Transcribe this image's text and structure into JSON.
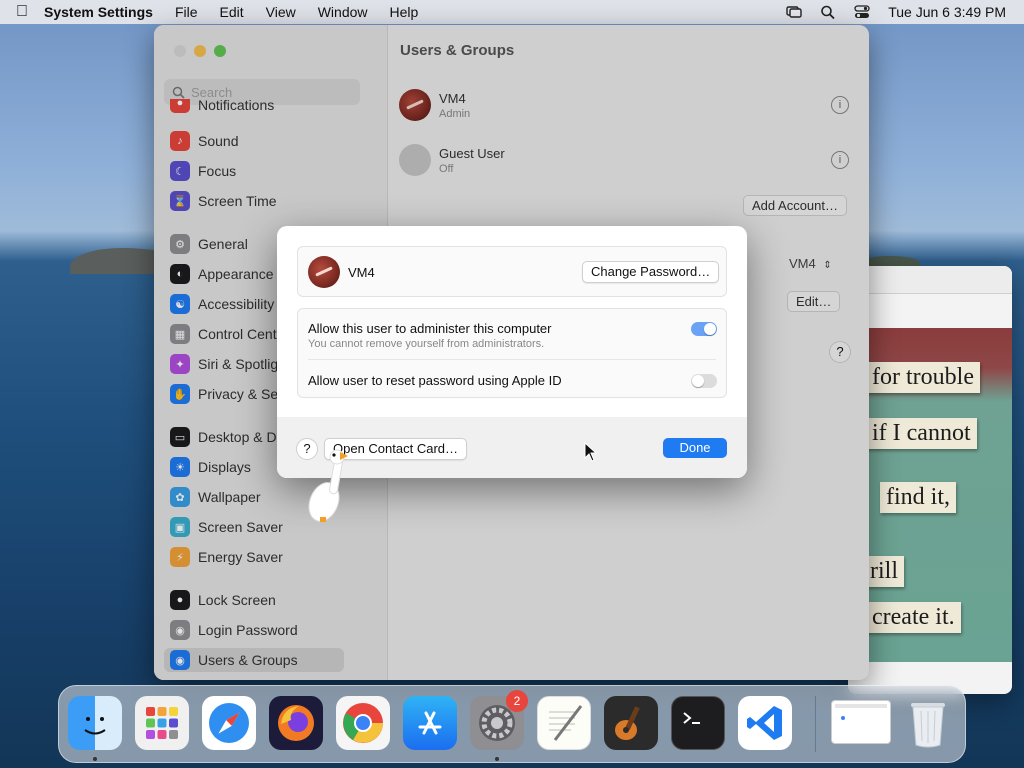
{
  "menubar": {
    "app_name": "System Settings",
    "menus": [
      "File",
      "Edit",
      "View",
      "Window",
      "Help"
    ],
    "datetime": "Tue Jun 6  3:49 PM"
  },
  "settings": {
    "title": "Users & Groups",
    "search_placeholder": "Search",
    "sidebar": [
      {
        "label": "Notifications",
        "icon": "bell-icon",
        "color": "#e8453c"
      },
      {
        "label": "Sound",
        "icon": "speaker-icon",
        "color": "#e8453c"
      },
      {
        "label": "Focus",
        "icon": "moon-icon",
        "color": "#5a4fcf"
      },
      {
        "label": "Screen Time",
        "icon": "hourglass-icon",
        "color": "#5a4fcf"
      },
      {
        "label": "General",
        "icon": "gear-icon",
        "color": "#8e8e93"
      },
      {
        "label": "Appearance",
        "icon": "appearance-icon",
        "color": "#1c1c1e"
      },
      {
        "label": "Accessibility",
        "icon": "accessibility-icon",
        "color": "#1f7bf2"
      },
      {
        "label": "Control Centre",
        "icon": "control-centre-icon",
        "color": "#8e8e93"
      },
      {
        "label": "Siri & Spotlight",
        "icon": "siri-icon",
        "color": "#b14fe0"
      },
      {
        "label": "Privacy & Security",
        "icon": "hand-icon",
        "color": "#1f7bf2"
      },
      {
        "label": "Desktop & Dock",
        "icon": "desktop-icon",
        "color": "#1c1c1e"
      },
      {
        "label": "Displays",
        "icon": "sun-icon",
        "color": "#1f7bf2"
      },
      {
        "label": "Wallpaper",
        "icon": "wallpaper-icon",
        "color": "#3aa0e6"
      },
      {
        "label": "Screen Saver",
        "icon": "screensaver-icon",
        "color": "#3ab0d0"
      },
      {
        "label": "Energy Saver",
        "icon": "battery-icon",
        "color": "#f2a33a"
      },
      {
        "label": "Lock Screen",
        "icon": "lock-icon",
        "color": "#1c1c1e"
      },
      {
        "label": "Login Password",
        "icon": "key-icon",
        "color": "#8e8e93"
      },
      {
        "label": "Users & Groups",
        "icon": "users-icon",
        "color": "#1f7bf2"
      }
    ],
    "users": [
      {
        "name": "VM4",
        "role": "Admin"
      },
      {
        "name": "Guest User",
        "role": "Off"
      }
    ],
    "add_account_label": "Add Account…",
    "auto_login_value": "VM4",
    "edit_label": "Edit…",
    "help_label": "?"
  },
  "sheet": {
    "user_name": "VM4",
    "change_password_label": "Change Password…",
    "admin_label": "Allow this user to administer this computer",
    "admin_note": "You cannot remove yourself from administrators.",
    "admin_enabled": true,
    "reset_label": "Allow user to reset password using Apple ID",
    "reset_enabled": false,
    "help_label": "?",
    "open_contact_label": "Open Contact Card…",
    "done_label": "Done"
  },
  "note": {
    "lines": [
      "for trouble",
      "if I cannot",
      "find it,",
      "rill",
      "create it."
    ]
  },
  "dock": {
    "apps": [
      {
        "name": "Finder",
        "icon": "finder-icon"
      },
      {
        "name": "Launchpad",
        "icon": "launchpad-icon"
      },
      {
        "name": "Safari",
        "icon": "safari-icon"
      },
      {
        "name": "Firefox",
        "icon": "firefox-icon"
      },
      {
        "name": "Chrome",
        "icon": "chrome-icon"
      },
      {
        "name": "App Store",
        "icon": "app-store-icon"
      },
      {
        "name": "System Settings",
        "icon": "system-settings-icon",
        "badge": "2"
      },
      {
        "name": "TextEdit",
        "icon": "textedit-icon"
      },
      {
        "name": "GarageBand",
        "icon": "guitar-icon"
      },
      {
        "name": "Terminal",
        "icon": "terminal-icon"
      },
      {
        "name": "VS Code",
        "icon": "vscode-icon"
      }
    ]
  }
}
